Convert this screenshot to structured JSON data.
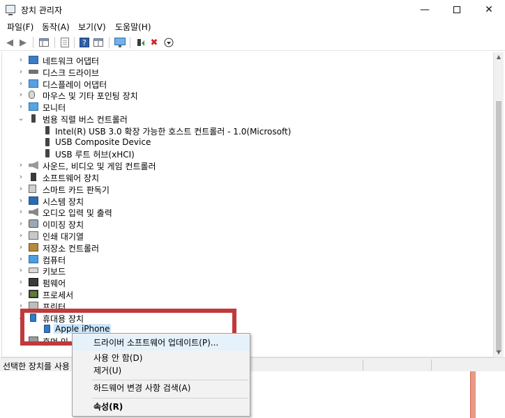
{
  "window": {
    "title": "장치 관리자",
    "controls": {
      "minimize": "—",
      "maximize": "",
      "close": "✕"
    }
  },
  "menu": [
    "파일(F)",
    "동작(A)",
    "보기(V)",
    "도움말(H)"
  ],
  "toolbar": {
    "back": "◀",
    "forward": "▶",
    "delete": "✖",
    "download": "⬇"
  },
  "tree": [
    {
      "label": "네트워크 어댑터",
      "chev": "›",
      "icon": "network-adapter-icon"
    },
    {
      "label": "디스크 드라이브",
      "chev": "›",
      "icon": "disk-drive-icon"
    },
    {
      "label": "디스플레이 어댑터",
      "chev": "›",
      "icon": "display-adapter-icon"
    },
    {
      "label": "마우스 및 기타 포인팅 장치",
      "chev": "›",
      "icon": "mouse-icon"
    },
    {
      "label": "모니터",
      "chev": "›",
      "icon": "monitor-icon"
    },
    {
      "label": "범용 직렬 버스 컨트롤러",
      "chev": "⌄",
      "icon": "usb-icon"
    },
    {
      "label": "Intel(R) USB 3.0 확장 가능한 호스트 컨트롤러 - 1.0(Microsoft)",
      "chev": "",
      "icon": "usb-icon"
    },
    {
      "label": "USB Composite Device",
      "chev": "",
      "icon": "usb-icon"
    },
    {
      "label": "USB 루트 허브(xHCI)",
      "chev": "",
      "icon": "usb-icon"
    },
    {
      "label": "사운드, 비디오 및 게임 컨트롤러",
      "chev": "›",
      "icon": "sound-icon"
    },
    {
      "label": "소프트웨어 장치",
      "chev": "›",
      "icon": "software-device-icon"
    },
    {
      "label": "스마트 카드 판독기",
      "chev": "›",
      "icon": "smart-card-icon"
    },
    {
      "label": "시스템 장치",
      "chev": "›",
      "icon": "system-device-icon"
    },
    {
      "label": "오디오 입력 및 출력",
      "chev": "›",
      "icon": "audio-icon"
    },
    {
      "label": "이미징 장치",
      "chev": "›",
      "icon": "imaging-icon"
    },
    {
      "label": "인쇄 대기열",
      "chev": "›",
      "icon": "print-queue-icon"
    },
    {
      "label": "저장소 컨트롤러",
      "chev": "›",
      "icon": "storage-controller-icon"
    },
    {
      "label": "컴퓨터",
      "chev": "›",
      "icon": "computer-icon"
    },
    {
      "label": "키보드",
      "chev": "›",
      "icon": "keyboard-icon"
    },
    {
      "label": "펌웨어",
      "chev": "›",
      "icon": "firmware-icon"
    },
    {
      "label": "프로세서",
      "chev": "›",
      "icon": "processor-icon"
    },
    {
      "label": "프린터",
      "chev": "›",
      "icon": "printer-icon"
    },
    {
      "label": "휴대용 장치",
      "chev": "⌄",
      "icon": "portable-device-icon"
    },
    {
      "label": "Apple iPhone",
      "chev": "",
      "icon": "iphone-icon"
    },
    {
      "label": "휴먼 인",
      "chev": "›",
      "icon": "hid-icon"
    }
  ],
  "status": {
    "text": "선택한 장치를 사용"
  },
  "context_menu": {
    "items": [
      "드라이버 소프트웨어 업데이트(P)...",
      "사용 안 함(D)",
      "제거(U)",
      "하드웨어 변경 사항 검색(A)",
      "속성(R)"
    ]
  },
  "colors": {
    "highlight_box": "#c0393b",
    "selection": "#cce8ff",
    "context_hover": "#e5f1fb"
  }
}
